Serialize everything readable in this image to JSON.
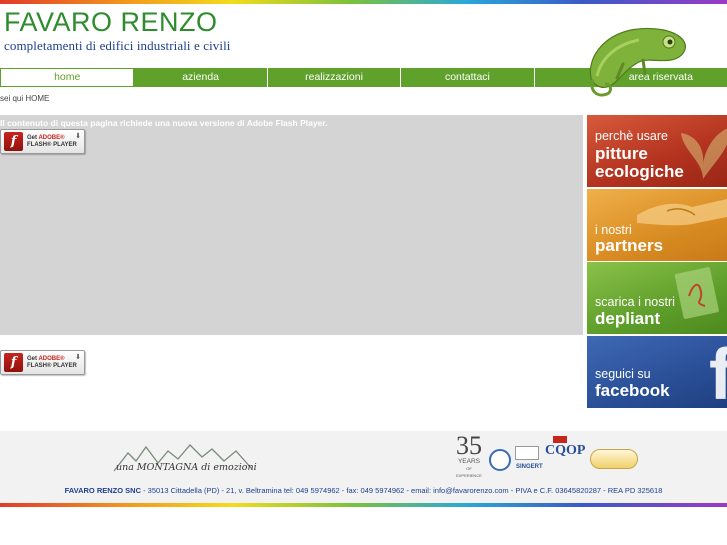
{
  "header": {
    "company_name": "FAVARO RENZO",
    "tagline": "completamenti di edifici industriali e civili"
  },
  "nav": {
    "items": [
      {
        "label": "home",
        "active": true
      },
      {
        "label": "azienda",
        "active": false
      },
      {
        "label": "realizzazioni",
        "active": false
      },
      {
        "label": "contattaci",
        "active": false
      },
      {
        "label": "area riservata",
        "active": false
      }
    ]
  },
  "breadcrumb": "sei qui HOME",
  "flash": {
    "message": "Il contenuto di questa pagina richiede una nuova versione di Adobe Flash Player.",
    "badge_line1_prefix": "Get ",
    "badge_line1_brand": "ADOBE®",
    "badge_line2": "FLASH® PLAYER"
  },
  "banners": [
    {
      "line1": "perchè usare",
      "line2": "pitture",
      "line3": "ecologiche"
    },
    {
      "line1": "i nostri",
      "line2": "partners"
    },
    {
      "line1": "scarica i nostri",
      "line2": "depliant"
    },
    {
      "line1": "seguici su",
      "line2": "facebook"
    }
  ],
  "footer": {
    "montagna_text": "una MONTAGNA di emozioni",
    "years_number": "35",
    "years_label": "YEARS",
    "years_sub": "OF EXPERIENCE",
    "singert_label": "SINGERT",
    "cqop_label": "CQOP",
    "company": "FAVARO RENZO SNC",
    "address": " - 35013 Cittadella (PD) - 21, v. Beltramina tel: 049 5974962 - fax: 049 5974962 - email: info@favarorenzo.com - PIVA e C.F. 03645820287 - REA PD 325618"
  },
  "colors": {
    "nav_green": "#5fa12a",
    "logo_green": "#2e8c2e",
    "logo_blue": "#1e3f8f",
    "flash_gray": "#d4d4d4",
    "banner_red": "#b2321f",
    "banner_orange": "#d98c22",
    "banner_green": "#5e9e2a",
    "banner_blue": "#2a4f97"
  },
  "icons": [
    "chameleon-mascot",
    "flash-player-icon",
    "leaf-icon",
    "handshake-icon",
    "pdf-icon",
    "facebook-icon",
    "mountain-logo",
    "certification-badge"
  ]
}
